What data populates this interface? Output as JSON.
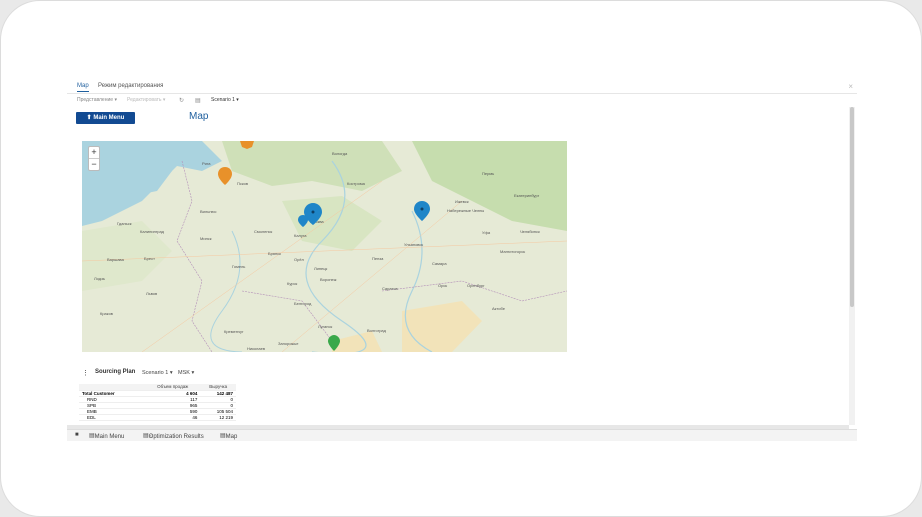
{
  "tabs": [
    {
      "label": "Map",
      "active": true
    },
    {
      "label": "Режим редактирования",
      "active": false
    }
  ],
  "toolbar": {
    "presentation": "Представление",
    "editing": "Редактировать",
    "scenario": "Scenario 1"
  },
  "content": {
    "main_menu_button": "⬆ Main Menu",
    "map_title": "Map"
  },
  "map": {
    "zoom_in": "+",
    "zoom_out": "−",
    "city_labels": [
      "Вологда",
      "Кострома",
      "Пермь",
      "Ижевск",
      "Набережные Челны",
      "Екатеринбург",
      "Уфа",
      "Челябинск",
      "Магнитогорск",
      "Калуга",
      "Москва",
      "Ульяновск",
      "Липецк",
      "Орёл",
      "Воронеж",
      "Оренбург",
      "Орск",
      "Белгород",
      "Саратов",
      "Актобе",
      "Луганск",
      "Волгоград",
      "Запорожье",
      "Кременчуг",
      "Николаев",
      "Львов",
      "Минск",
      "Гомель",
      "Варшава",
      "Вильнюс",
      "Рига",
      "Лодзь",
      "Краков",
      "Брест",
      "Гданьск",
      "Калининград",
      "Псков",
      "Смоленск",
      "Брянск",
      "Курск",
      "Пенза",
      "Самара"
    ],
    "markers": [
      {
        "color": "#e8912a",
        "label": "orange-marker"
      },
      {
        "color": "#1f86c8",
        "label": "blue-marker-moscow"
      },
      {
        "color": "#1f86c8",
        "label": "blue-marker-volga"
      },
      {
        "color": "#3aa84a",
        "label": "green-marker"
      },
      {
        "color": "#e8912a",
        "label": "orange-marker-top"
      }
    ]
  },
  "sourcing": {
    "title": "Sourcing Plan",
    "scenario": "Scenario 1",
    "currency": "MSK",
    "columns": [
      "",
      "Объем продаж",
      "Выручка"
    ],
    "rows": [
      {
        "name": "Total Customer",
        "volume": "4 604",
        "revenue": "142 487",
        "total": true
      },
      {
        "name": "RND",
        "volume": "117",
        "revenue": "0",
        "total": false
      },
      {
        "name": "SPB",
        "volume": "965",
        "revenue": "0",
        "total": false
      },
      {
        "name": "EMB",
        "volume": "590",
        "revenue": "105 504",
        "total": false
      },
      {
        "name": "EDL",
        "volume": "46",
        "revenue": "12 219",
        "total": false
      }
    ]
  },
  "bottom_tabs": [
    {
      "label": "Main Menu"
    },
    {
      "label": "Optimization Results"
    },
    {
      "label": "Map"
    }
  ],
  "colors": {
    "accent": "#124a92",
    "title": "#1f5f9e"
  }
}
